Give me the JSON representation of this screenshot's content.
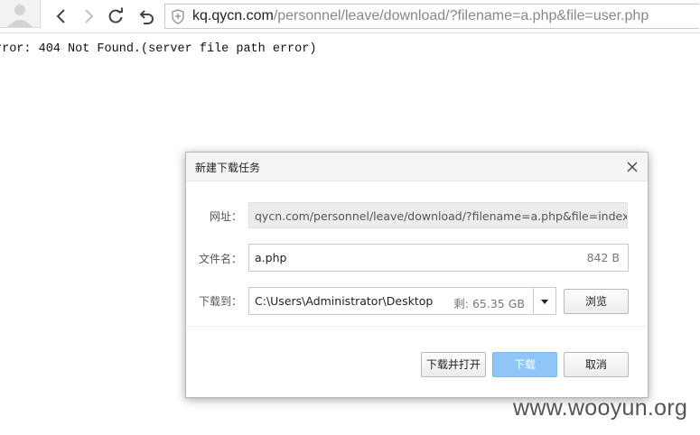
{
  "browser": {
    "url_host": "kq.qycn.com",
    "url_path": "/personnel/leave/download/?filename=a.php&file=user.php"
  },
  "page": {
    "error_text": "rror: 404 Not Found.(server file path error)"
  },
  "dialog": {
    "title": "新建下载任务",
    "url_label": "网址：",
    "url_value": "qycn.com/personnel/leave/download/?filename=a.php&file=index.php",
    "filename_label": "文件名：",
    "filename_value": "a.php",
    "file_size": "842 B",
    "saveto_label": "下载到：",
    "saveto_value": "C:\\Users\\Administrator\\Desktop",
    "free_space": "剩: 65.35 GB",
    "browse_label": "浏览",
    "download_open_label": "下载并打开",
    "download_label": "下载",
    "cancel_label": "取消"
  },
  "watermark": "www.wooyun.org",
  "icons": {
    "back": "back-arrow-icon",
    "forward": "forward-arrow-icon",
    "refresh": "refresh-icon",
    "undo": "undo-icon",
    "shield": "shield-icon",
    "close": "close-icon",
    "dropdown": "dropdown-triangle-icon"
  },
  "colors": {
    "primary_button": "#8ec7f7",
    "readonly_field": "#ececec"
  }
}
